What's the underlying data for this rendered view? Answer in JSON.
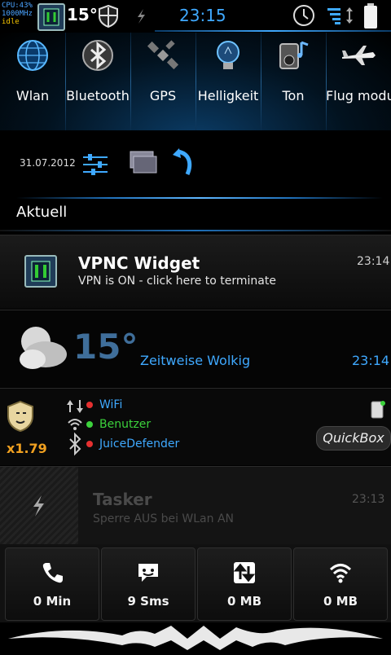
{
  "status_bar": {
    "cpu": "CPU:43%",
    "freq": "1000MHz",
    "state": "idle",
    "temperature": "15°",
    "time": "23:15"
  },
  "toggles": [
    {
      "label": "Wlan",
      "icon": "globe-wifi-icon"
    },
    {
      "label": "Bluetooth",
      "icon": "bluetooth-icon"
    },
    {
      "label": "GPS",
      "icon": "satellite-icon"
    },
    {
      "label": "Helligkeit",
      "icon": "lightbulb-icon"
    },
    {
      "label": "Ton",
      "icon": "speaker-icon"
    },
    {
      "label": "Flug modus",
      "icon": "airplane-icon"
    }
  ],
  "date": "31.07.2012",
  "section_header": "Aktuell",
  "notifications": {
    "vpnc": {
      "title": "VPNC Widget",
      "subtitle": "VPN is ON - click here to terminate",
      "time": "23:14"
    },
    "weather": {
      "temperature": "15°",
      "condition": "Zeitweise Wolkig",
      "time": "23:14"
    },
    "juice": {
      "multiplier": "x1.79",
      "items": [
        {
          "label": "WiFi",
          "status_color": "#e53030"
        },
        {
          "label": "Benutzer",
          "status_color": "#3cd23c"
        },
        {
          "label": "JuiceDefender",
          "status_color": "#e53030"
        }
      ],
      "quickbox": "QuickBox"
    },
    "tasker": {
      "title": "Tasker",
      "subtitle": "Sperre AUS bei WLan AN",
      "time": "23:13"
    }
  },
  "bottom_bar": [
    {
      "label": "0 Min",
      "icon": "phone-icon"
    },
    {
      "label": "9 Sms",
      "icon": "message-icon"
    },
    {
      "label": "0 MB",
      "icon": "data-transfer-icon"
    },
    {
      "label": "0 MB",
      "icon": "wifi-icon"
    }
  ],
  "colors": {
    "accent": "#3fa9ff",
    "orange": "#f0a020"
  }
}
